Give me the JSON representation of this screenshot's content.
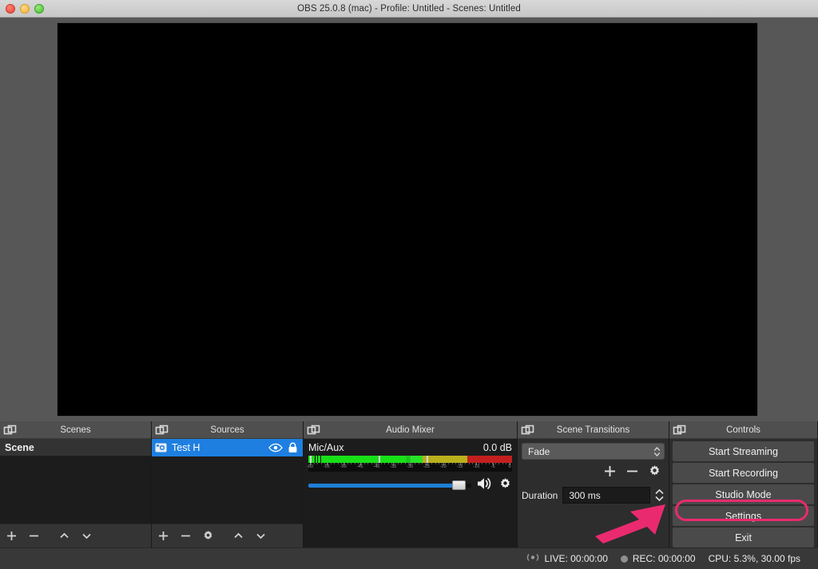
{
  "window": {
    "title": "OBS 25.0.8 (mac) - Profile: Untitled - Scenes: Untitled",
    "traffic_lights": [
      "close-button",
      "minimize-button",
      "maximize-button"
    ]
  },
  "preview": {
    "name": "preview-canvas",
    "background": "#000000"
  },
  "docks": {
    "scenes": {
      "title": "Scenes",
      "items": [
        {
          "label": "Scene",
          "selected": true
        }
      ],
      "toolbar": [
        {
          "name": "add-scene-button",
          "glyph": "+"
        },
        {
          "name": "remove-scene-button",
          "glyph": "−"
        },
        {
          "name": "move-scene-up-button",
          "glyph": "⌃"
        },
        {
          "name": "move-scene-down-button",
          "glyph": "⌄"
        }
      ]
    },
    "sources": {
      "title": "Sources",
      "items": [
        {
          "label": "Test H",
          "selected": true,
          "visible": true,
          "locked": true
        }
      ],
      "toolbar": [
        {
          "name": "add-source-button",
          "glyph": "+"
        },
        {
          "name": "remove-source-button",
          "glyph": "−"
        },
        {
          "name": "source-properties-button",
          "glyph": "gear"
        },
        {
          "name": "move-source-up-button",
          "glyph": "⌃"
        },
        {
          "name": "move-source-down-button",
          "glyph": "⌄"
        }
      ]
    },
    "mixer": {
      "title": "Audio Mixer",
      "channel_name": "Mic/Aux",
      "level_db": "0.0 dB",
      "scale_ticks": [
        "-60",
        "-55",
        "-50",
        "-45",
        "-40",
        "-35",
        "-30",
        "-25",
        "-20",
        "-15",
        "-10",
        "-5",
        "0"
      ],
      "volume_percent": 89,
      "mute_icon": "speaker-icon",
      "settings_icon": "gear-icon"
    },
    "transitions": {
      "title": "Scene Transitions",
      "transition": "Fade",
      "add_label": "+",
      "remove_label": "−",
      "properties_label": "gear",
      "duration_label": "Duration",
      "duration_value": "300 ms"
    },
    "controls": {
      "title": "Controls",
      "buttons": [
        {
          "label": "Start Streaming",
          "name": "start-streaming-button"
        },
        {
          "label": "Start Recording",
          "name": "start-recording-button"
        },
        {
          "label": "Studio Mode",
          "name": "studio-mode-button"
        },
        {
          "label": "Settings",
          "name": "settings-button",
          "highlighted": true
        },
        {
          "label": "Exit",
          "name": "exit-button"
        }
      ]
    }
  },
  "statusbar": {
    "live": "LIVE: 00:00:00",
    "rec": "REC: 00:00:00",
    "cpu": "CPU: 5.3%, 30.00 fps"
  },
  "annotation": {
    "color": "#ea2a6f",
    "target": "Settings"
  }
}
